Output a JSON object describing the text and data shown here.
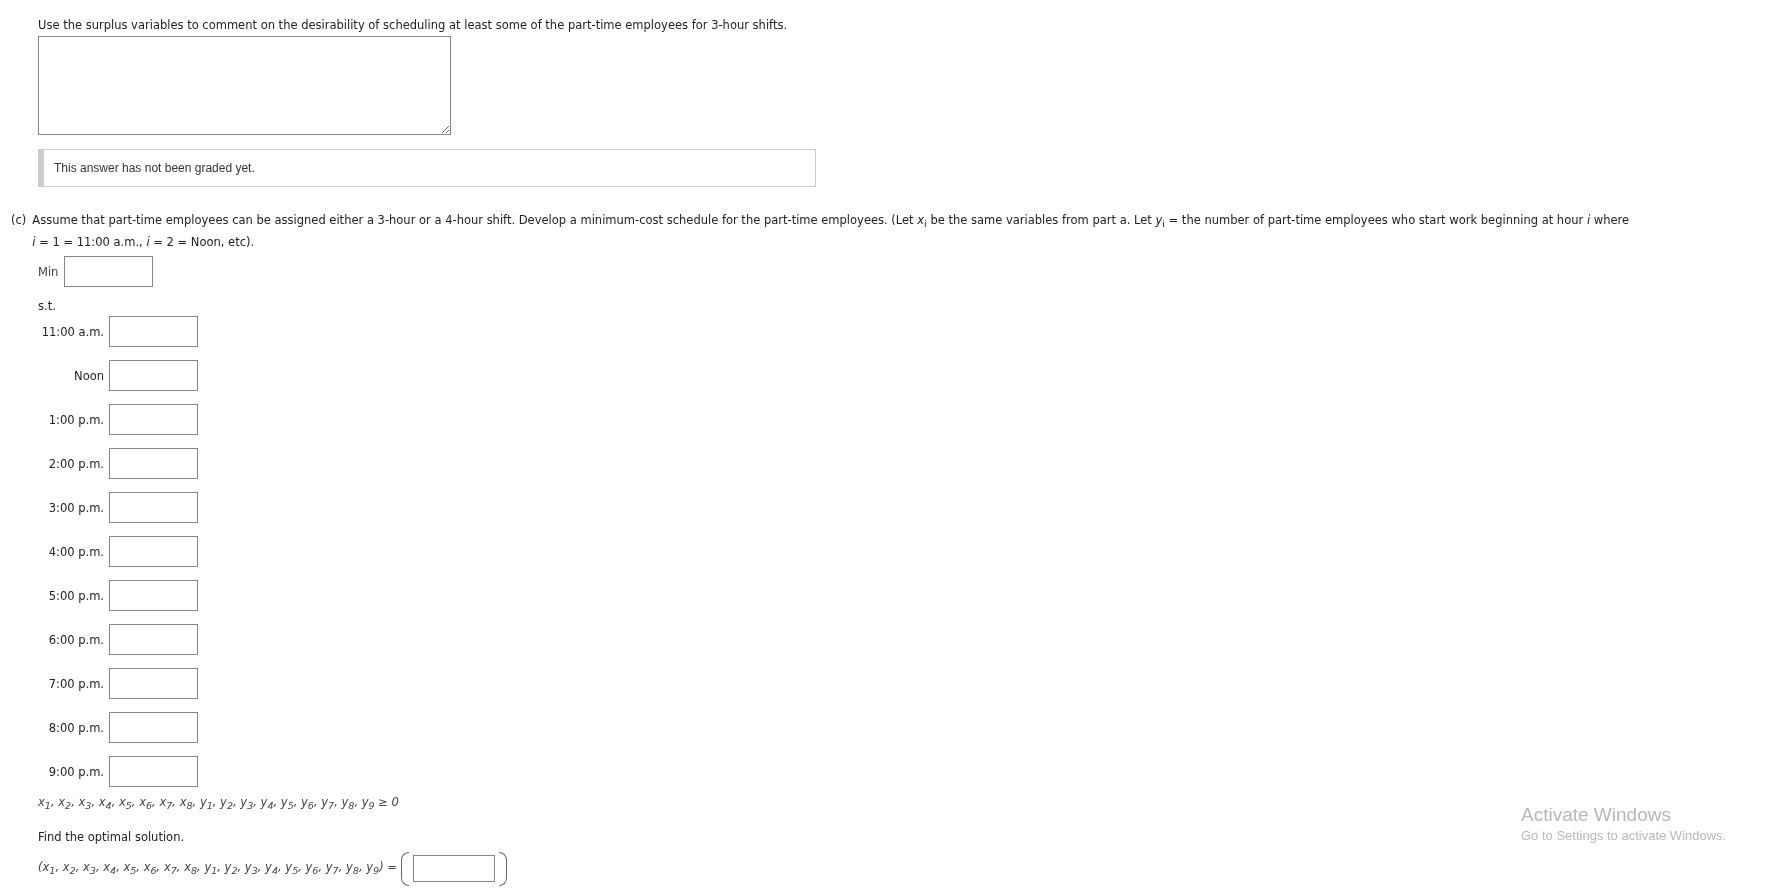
{
  "part_b": {
    "prompt": "Use the surplus variables to comment on the desirability of scheduling at least some of the part-time employees for 3-hour shifts.",
    "grading_note": "This answer has not been graded yet."
  },
  "part_c": {
    "label": "(c)",
    "prompt_line_1": "Assume that part-time employees can be assigned either a 3-hour or a 4-hour shift. Develop a minimum-cost schedule for the part-time employees. (Let *x*$_{i}$ be the same variables from part a. Let *y*$_{i}$ = the number of part-time employees who start work beginning at hour *i* where",
    "prompt_line_2": "*i* = 1 = 11:00 a.m., *i* = 2 = Noon, etc).",
    "objective_label": "Min",
    "st_label": "s.t.",
    "constraints": [
      {
        "label": "11:00 a.m."
      },
      {
        "label": "Noon"
      },
      {
        "label": "1:00 p.m."
      },
      {
        "label": "2:00 p.m."
      },
      {
        "label": "3:00 p.m."
      },
      {
        "label": "4:00 p.m."
      },
      {
        "label": "5:00 p.m."
      },
      {
        "label": "6:00 p.m."
      },
      {
        "label": "7:00 p.m."
      },
      {
        "label": "8:00 p.m."
      },
      {
        "label": "9:00 p.m."
      }
    ],
    "nonnegativity": "*x*$_{1}$, *x*$_{2}$, *x*$_{3}$, *x*$_{4}$, *x*$_{5}$, *x*$_{6}$, *x*$_{7}$, *x*$_{8}$, *y*$_{1}$, *y*$_{2}$, *y*$_{3}$, *y*$_{4}$, *y*$_{5}$, *y*$_{6}$, *y*$_{7}$, *y*$_{8}$, *y*$_{9}$ ≥ 0",
    "solution_prompt": "Find the optimal solution.",
    "solution_vector": "(*x*$_{1}$, *x*$_{2}$, *x*$_{3}$, *x*$_{4}$, *x*$_{5}$, *x*$_{6}$, *x*$_{7}$, *x*$_{8}$, *y*$_{1}$, *y*$_{2}$, *y*$_{3}$, *y*$_{4}$, *y*$_{5}$, *y*$_{6}$, *y*$_{7}$, *y*$_{8}$, *y*$_{9}$) ="
  },
  "os_notice": {
    "title": "Activate Windows",
    "subtitle": "Go to Settings to activate Windows."
  }
}
